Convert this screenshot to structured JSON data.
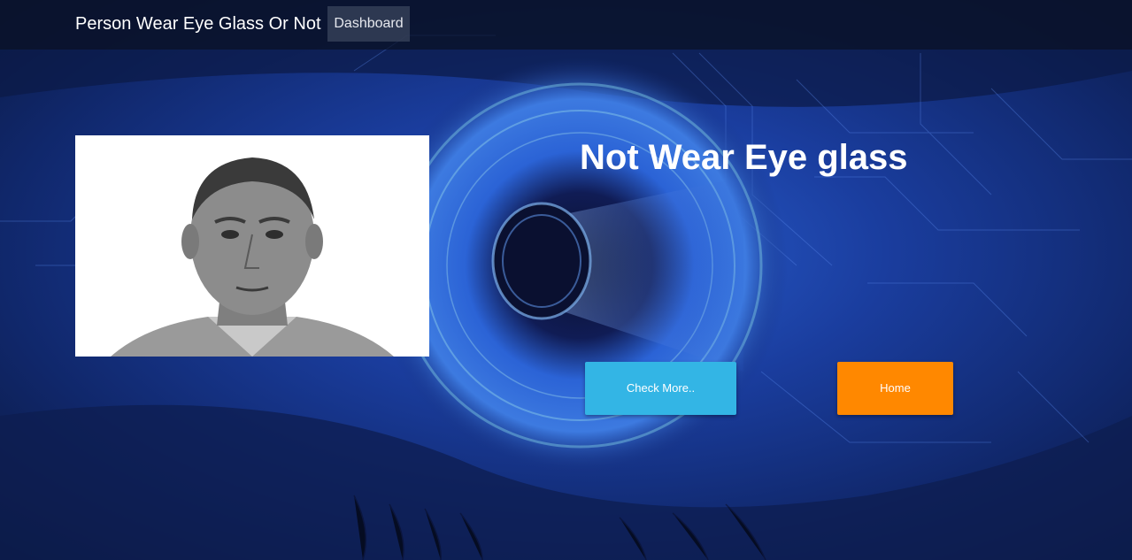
{
  "navbar": {
    "brand": "Person Wear Eye Glass Or Not",
    "links": [
      {
        "label": "Dashboard"
      }
    ]
  },
  "main": {
    "result_title": "Not Wear Eye glass",
    "buttons": {
      "check_more": "Check More..",
      "home": "Home"
    }
  },
  "colors": {
    "background": "#0b1a44",
    "check_more_button": "#33b5e5",
    "home_button": "#ff8800",
    "navbar": "#0a1024"
  },
  "icons": {
    "background": "digital-eye-illustration",
    "photo": "person-portrait-photo"
  }
}
